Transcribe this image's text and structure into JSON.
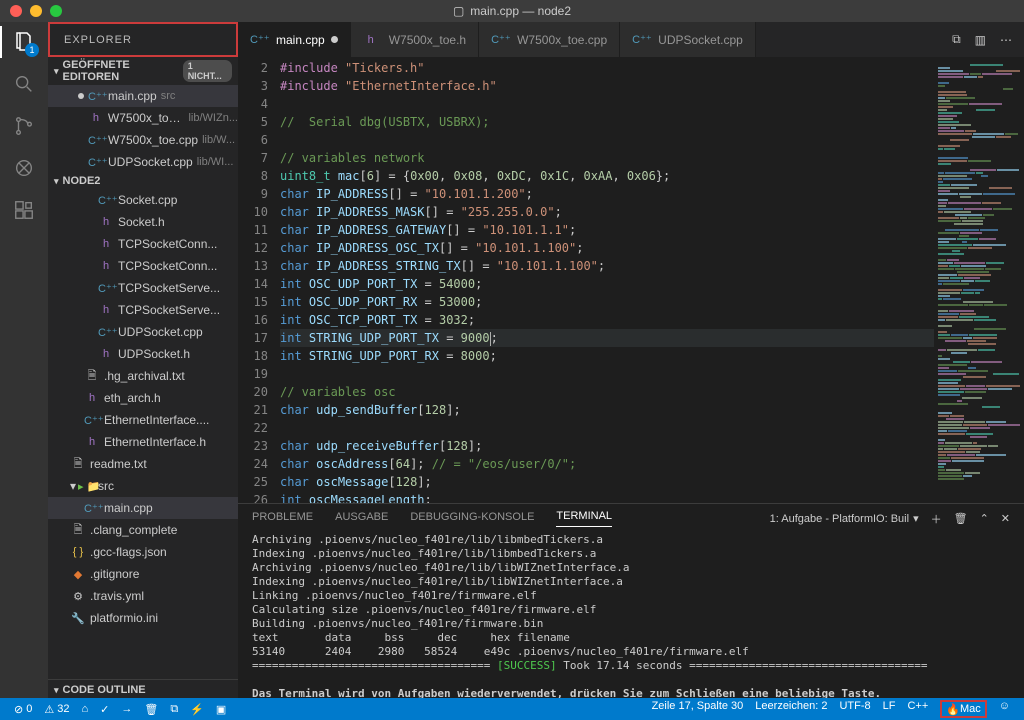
{
  "window": {
    "title": "main.cpp — node2",
    "file_icon": "▢"
  },
  "activitybar": {
    "explorer_badge": "1"
  },
  "sidebar": {
    "title": "EXPLORER",
    "open_editors": {
      "heading": "GEÖFFNETE EDITOREN",
      "badge": "1 NICHT...",
      "items": [
        {
          "icon": "C++",
          "name": "main.cpp",
          "sub": "src",
          "modified": true,
          "selected": true
        },
        {
          "icon": "h",
          "name": "W7500x_toe.h",
          "sub": "lib/WIZn..."
        },
        {
          "icon": "C++",
          "name": "W7500x_toe.cpp",
          "sub": "lib/W..."
        },
        {
          "icon": "C++",
          "name": "UDPSocket.cpp",
          "sub": "lib/WI..."
        }
      ]
    },
    "workspace": {
      "heading": "NODE2",
      "items": [
        {
          "icon": "C++",
          "name": "Socket.cpp",
          "depth": 3
        },
        {
          "icon": "h",
          "name": "Socket.h",
          "depth": 3
        },
        {
          "icon": "h",
          "name": "TCPSocketConn...",
          "depth": 3
        },
        {
          "icon": "h",
          "name": "TCPSocketConn...",
          "depth": 3
        },
        {
          "icon": "C++",
          "name": "TCPSocketServe...",
          "depth": 3
        },
        {
          "icon": "h",
          "name": "TCPSocketServe...",
          "depth": 3
        },
        {
          "icon": "C++",
          "name": "UDPSocket.cpp",
          "depth": 3
        },
        {
          "icon": "h",
          "name": "UDPSocket.h",
          "depth": 3
        },
        {
          "icon": "txt",
          "name": ".hg_archival.txt",
          "depth": 2
        },
        {
          "icon": "h",
          "name": "eth_arch.h",
          "depth": 2
        },
        {
          "icon": "C++",
          "name": "EthernetInterface....",
          "depth": 2
        },
        {
          "icon": "h",
          "name": "EthernetInterface.h",
          "depth": 2
        },
        {
          "icon": "txt",
          "name": "readme.txt",
          "depth": 1
        },
        {
          "icon": "folder",
          "name": "src",
          "depth": 1,
          "expandable": true
        },
        {
          "icon": "C++",
          "name": "main.cpp",
          "depth": 2,
          "selected": true
        },
        {
          "icon": "txt",
          "name": ".clang_complete",
          "depth": 1
        },
        {
          "icon": "json",
          "name": ".gcc-flags.json",
          "depth": 1
        },
        {
          "icon": "git",
          "name": ".gitignore",
          "depth": 1
        },
        {
          "icon": "gear",
          "name": ".travis.yml",
          "depth": 1
        },
        {
          "icon": "plat",
          "name": "platformio.ini",
          "depth": 1
        }
      ]
    },
    "outline": {
      "heading": "CODE OUTLINE"
    }
  },
  "tabs": [
    {
      "icon": "C++",
      "name": "main.cpp",
      "active": true,
      "modified": true
    },
    {
      "icon": "h",
      "name": "W7500x_toe.h"
    },
    {
      "icon": "C++",
      "name": "W7500x_toe.cpp"
    },
    {
      "icon": "C++",
      "name": "UDPSocket.cpp"
    }
  ],
  "code": {
    "first_line": 2,
    "current_line": 17,
    "lines": [
      {
        "n": 2,
        "html": "<span class='pp'>#include</span> <span class='str'>\"Tickers.h\"</span>"
      },
      {
        "n": 3,
        "html": "<span class='pp'>#include</span> <span class='str'>\"EthernetInterface.h\"</span>"
      },
      {
        "n": 4,
        "html": ""
      },
      {
        "n": 5,
        "html": "<span class='cmt'>//  Serial dbg(USBTX, USBRX);</span>"
      },
      {
        "n": 6,
        "html": ""
      },
      {
        "n": 7,
        "html": "<span class='cmt'>// variables network</span>"
      },
      {
        "n": 8,
        "html": "<span class='ty'>uint8_t</span> <span class='var'>mac</span>[<span class='num'>6</span>] = {<span class='num'>0x00</span>, <span class='num'>0x08</span>, <span class='num'>0xDC</span>, <span class='num'>0x1C</span>, <span class='num'>0xAA</span>, <span class='num'>0x06</span>};"
      },
      {
        "n": 9,
        "html": "<span class='kw'>char</span> <span class='var'>IP_ADDRESS</span>[] = <span class='str'>\"10.101.1.200\"</span>;"
      },
      {
        "n": 10,
        "html": "<span class='kw'>char</span> <span class='var'>IP_ADDRESS_MASK</span>[] = <span class='str'>\"255.255.0.0\"</span>;"
      },
      {
        "n": 11,
        "html": "<span class='kw'>char</span> <span class='var'>IP_ADDRESS_GATEWAY</span>[] = <span class='str'>\"10.101.1.1\"</span>;"
      },
      {
        "n": 12,
        "html": "<span class='kw'>char</span> <span class='var'>IP_ADDRESS_OSC_TX</span>[] = <span class='str'>\"10.101.1.100\"</span>;"
      },
      {
        "n": 13,
        "html": "<span class='kw'>char</span> <span class='var'>IP_ADDRESS_STRING_TX</span>[] = <span class='str'>\"10.101.1.100\"</span>;"
      },
      {
        "n": 14,
        "html": "<span class='kw'>int</span> <span class='var'>OSC_UDP_PORT_TX</span> = <span class='num'>54000</span>;"
      },
      {
        "n": 15,
        "html": "<span class='kw'>int</span> <span class='var'>OSC_UDP_PORT_RX</span> = <span class='num'>53000</span>;"
      },
      {
        "n": 16,
        "html": "<span class='kw'>int</span> <span class='var'>OSC_TCP_PORT_TX</span> = <span class='num'>3032</span>;"
      },
      {
        "n": 17,
        "html": "<span class='kw'>int</span> <span class='var'>STRING_UDP_PORT_TX</span> = <span class='num'>9000</span>",
        "hl": true,
        "cursor_after": true,
        "trailing": ";"
      },
      {
        "n": 18,
        "html": "<span class='kw'>int</span> <span class='var'>STRING_UDP_PORT_RX</span> = <span class='num'>8000</span>;"
      },
      {
        "n": 19,
        "html": ""
      },
      {
        "n": 20,
        "html": "<span class='cmt'>// variables osc</span>"
      },
      {
        "n": 21,
        "html": "<span class='kw'>char</span> <span class='var'>udp_sendBuffer</span>[<span class='num'>128</span>];"
      },
      {
        "n": 22,
        "html": ""
      },
      {
        "n": 23,
        "html": "<span class='kw'>char</span> <span class='var'>udp_receiveBuffer</span>[<span class='num'>128</span>];"
      },
      {
        "n": 24,
        "html": "<span class='kw'>char</span> <span class='var'>oscAddress</span>[<span class='num'>64</span>]; <span class='cmt'>// = \"/eos/user/0/\";</span>"
      },
      {
        "n": 25,
        "html": "<span class='kw'>char</span> <span class='var'>oscMessage</span>[<span class='num'>128</span>];"
      },
      {
        "n": 26,
        "html": "<span class='kw'>int</span> <span class='var'>oscMessageLength</span>;"
      }
    ]
  },
  "panel": {
    "tabs": {
      "problems": "PROBLEME",
      "output": "AUSGABE",
      "debug": "DEBUGGING-KONSOLE",
      "terminal": "TERMINAL"
    },
    "select": "1: Aufgabe - PlatformIO: Buil",
    "terminal_text": "Archiving .pioenvs/nucleo_f401re/lib/libmbedTickers.a\nIndexing .pioenvs/nucleo_f401re/lib/libmbedTickers.a\nArchiving .pioenvs/nucleo_f401re/lib/libWIZnetInterface.a\nIndexing .pioenvs/nucleo_f401re/lib/libWIZnetInterface.a\nLinking .pioenvs/nucleo_f401re/firmware.elf\nCalculating size .pioenvs/nucleo_f401re/firmware.elf\nBuilding .pioenvs/nucleo_f401re/firmware.bin\ntext       data     bss     dec     hex filename\n53140      2404    2980   58524    e49c .pioenvs/nucleo_f401re/firmware.elf",
    "success_line_eq": "====================================",
    "success_label": "[SUCCESS]",
    "success_rest": " Took 17.14 seconds ",
    "hint": "Das Terminal wird von Aufgaben wiederverwendet, drücken Sie zum Schließen eine beliebige Taste."
  },
  "statusbar": {
    "errors": "0",
    "warnings": "32",
    "cursor": "Zeile 17, Spalte 30",
    "spaces": "Leerzeichen: 2",
    "encoding": "UTF-8",
    "eol": "LF",
    "lang": "C++",
    "mac": "Mac"
  }
}
